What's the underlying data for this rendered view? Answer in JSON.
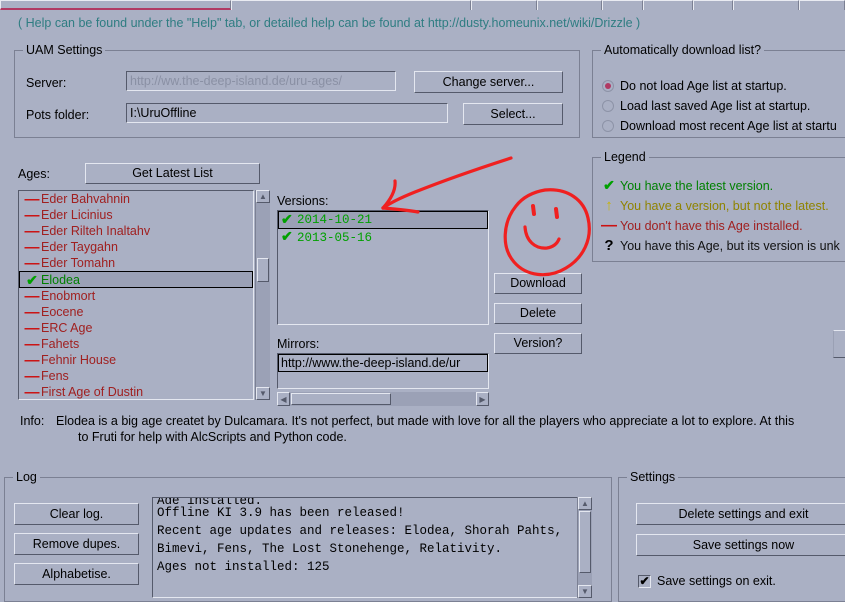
{
  "window": {
    "help_line": "( Help can be found under the \"Help\" tab, or detailed help can be found at http://dusty.homeunix.net/wiki/Drizzle  )"
  },
  "tabs": [
    {
      "label": "",
      "active": true
    },
    {
      "label": "",
      "active": false
    },
    {
      "label": "",
      "active": false
    },
    {
      "label": "",
      "active": false
    },
    {
      "label": "",
      "active": false
    },
    {
      "label": "",
      "active": false
    },
    {
      "label": "",
      "active": false
    },
    {
      "label": "",
      "active": false
    },
    {
      "label": "",
      "active": false
    }
  ],
  "uam_settings": {
    "title": "UAM Settings",
    "server_label": "Server:",
    "server_value": "",
    "server_placeholder": "http://ww.the-deep-island.de/uru-ages/",
    "change_server_label": "Change server...",
    "pots_label": "Pots folder:",
    "pots_value": "I:\\UruOffline",
    "select_label": "Select..."
  },
  "auto_download": {
    "title": "Automatically download list?",
    "accent": "#b03a63",
    "options": [
      {
        "label": "Do not load Age list at startup.",
        "checked": true
      },
      {
        "label": "Load last saved Age list at startup.",
        "checked": false
      },
      {
        "label": "Download most recent Age list at startu",
        "checked": false
      }
    ]
  },
  "legend": {
    "title": "Legend",
    "items": [
      {
        "glyph": "✔",
        "text": "You have the latest version.",
        "kind": "latest",
        "color": "#008000"
      },
      {
        "glyph": "↑",
        "text": "You have a version, but not the latest.",
        "kind": "older",
        "color": "#8f8300"
      },
      {
        "glyph": "—",
        "text": "You don't have this Age installed.",
        "kind": "missing",
        "color": "#a02020"
      },
      {
        "glyph": "?",
        "text": "You have this Age, but its version is unk",
        "kind": "unknown",
        "color": "#111111"
      }
    ]
  },
  "ages": {
    "label": "Ages:",
    "get_latest_label": "Get Latest List",
    "items": [
      {
        "name": "Eder Bahvahnin",
        "status": "missing",
        "glyph": "—",
        "selected": false
      },
      {
        "name": "Eder Licinius",
        "status": "missing",
        "glyph": "—",
        "selected": false
      },
      {
        "name": "Eder Rilteh Inaltahv",
        "status": "missing",
        "glyph": "—",
        "selected": false
      },
      {
        "name": "Eder Taygahn",
        "status": "missing",
        "glyph": "—",
        "selected": false
      },
      {
        "name": "Eder Tomahn",
        "status": "missing",
        "glyph": "—",
        "selected": false
      },
      {
        "name": "Elodea",
        "status": "latest",
        "glyph": "✔",
        "selected": true
      },
      {
        "name": "Enobmort",
        "status": "missing",
        "glyph": "—",
        "selected": false
      },
      {
        "name": "Eocene",
        "status": "missing",
        "glyph": "—",
        "selected": false
      },
      {
        "name": "ERC Age",
        "status": "missing",
        "glyph": "—",
        "selected": false
      },
      {
        "name": "Fahets",
        "status": "missing",
        "glyph": "—",
        "selected": false
      },
      {
        "name": "Fehnir House",
        "status": "missing",
        "glyph": "—",
        "selected": false
      },
      {
        "name": "Fens",
        "status": "missing",
        "glyph": "—",
        "selected": false
      },
      {
        "name": "First Age of Dustin",
        "status": "missing",
        "glyph": "—",
        "selected": false
      }
    ]
  },
  "versions": {
    "label": "Versions:",
    "items": [
      {
        "date": "2014-10-21",
        "glyph": "✔",
        "selected": true
      },
      {
        "date": "2013-05-16",
        "glyph": "✔",
        "selected": false
      }
    ]
  },
  "mirrors": {
    "label": "Mirrors:",
    "items": [
      {
        "url": "http://www.the-deep-island.de/ur"
      }
    ]
  },
  "action_buttons": {
    "download": "Download",
    "delete": "Delete",
    "version": "Version?"
  },
  "info": {
    "label": "Info:",
    "line1": "Elodea is a big age createt by Dulcamara. It's not perfect, but made with love for all the players who appreciate a lot to explore. At this",
    "line2": "to Fruti for help with AlcScripts and Python code."
  },
  "log": {
    "title": "Log",
    "clear_label": "Clear log.",
    "remove_dupes_label": "Remove dupes.",
    "alphabetise_label": "Alphabetise.",
    "lines": [
      "Age installed.",
      "Offline KI 3.9 has been released!",
      "Recent age updates and releases: Elodea, Shorah Pahts,",
      "Bimevi, Fens, The Lost Stonehenge, Relativity.",
      "Ages not installed: 125"
    ]
  },
  "settings": {
    "title": "Settings",
    "delete_label": "Delete settings and exit",
    "save_now_label": "Save settings now",
    "save_on_exit_label": "Save settings on exit.",
    "save_on_exit_checked": true,
    "check_glyph": "✔"
  },
  "annotations": {
    "arrow_color": "#f02020",
    "face_color": "#f02020"
  }
}
